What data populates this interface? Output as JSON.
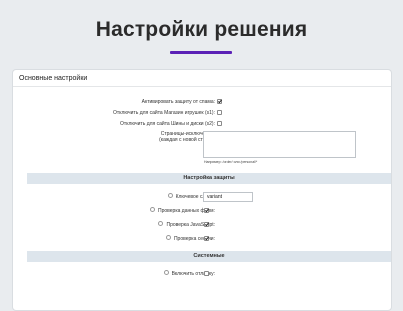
{
  "page": {
    "title": "Настройки решения",
    "accent_color": "#5b21b6"
  },
  "panel": {
    "header": "Основные настройки",
    "general": {
      "spam_protection_label": "Активировать защиту от спама:",
      "disable_toy_store_label": "Отключить для сайта Магазин игрушек (s1):",
      "disable_tires_label": "Отключить для сайта Шины и диски (s2):",
      "exclusions_label_line1": "Страницы-исключения:",
      "exclusions_label_line2": "(каждая с новой строки)",
      "exclusions_value": "",
      "exclusions_hint": "Например: /order/ или /personal/*"
    },
    "protection": {
      "title": "Настройка защиты",
      "keyword_label": "Ключевое слово:",
      "keyword_value": "variant",
      "form_check_label": "Проверка данных форм:",
      "js_check_label": "Проверка JavaScript:",
      "session_check_label": "Проверка сессии:"
    },
    "system": {
      "title": "Системные",
      "debug_label": "Включить отладку:"
    }
  },
  "checkbox_states": {
    "spam_protection": true,
    "disable_toy_store": false,
    "disable_tires": false,
    "form_check": true,
    "js_check": true,
    "session_check": true,
    "debug": false
  }
}
